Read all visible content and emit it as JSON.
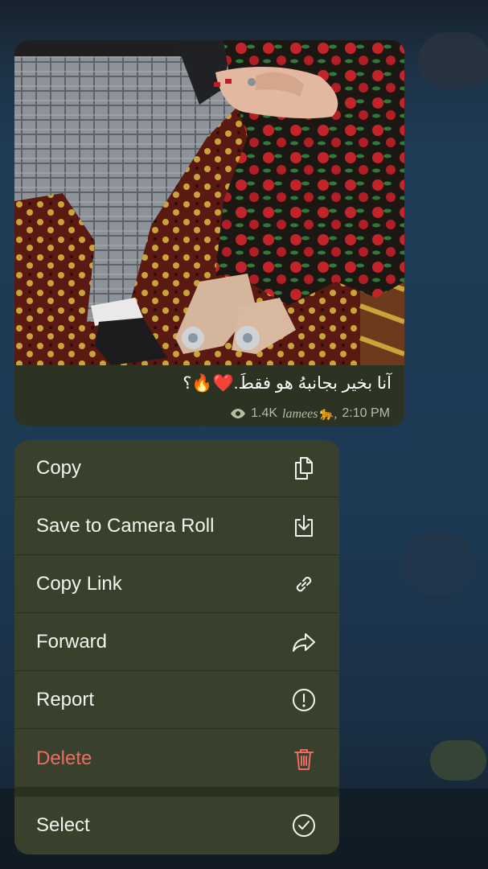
{
  "message": {
    "caption": "آنا بخير بجانبهُ هو فقطَ.❤️🔥؟",
    "views": "1.4K",
    "author": "lamees🐆,",
    "time": "2:10 PM"
  },
  "menu": {
    "items": [
      {
        "label": "Copy",
        "icon": "copy-icon"
      },
      {
        "label": "Save to Camera Roll",
        "icon": "download-icon"
      },
      {
        "label": "Copy Link",
        "icon": "link-icon"
      },
      {
        "label": "Forward",
        "icon": "forward-icon"
      },
      {
        "label": "Report",
        "icon": "report-icon"
      },
      {
        "label": "Delete",
        "icon": "trash-icon"
      },
      {
        "label": "Select",
        "icon": "check-circle-icon"
      }
    ],
    "danger_color": "#ee6c62"
  }
}
